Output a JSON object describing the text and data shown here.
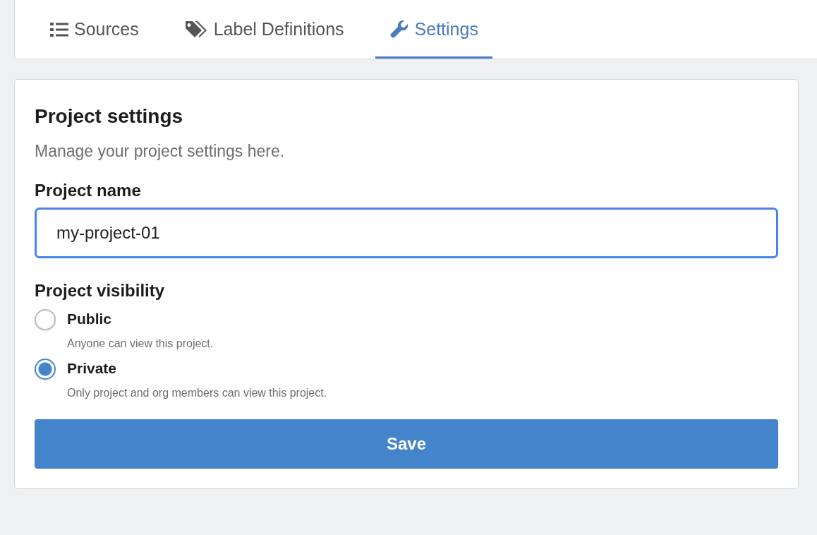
{
  "tabs": [
    {
      "label": "Sources",
      "selected": false
    },
    {
      "label": "Label Definitions",
      "selected": false
    },
    {
      "label": "Settings",
      "selected": true
    }
  ],
  "panel": {
    "title": "Project settings",
    "subtitle": "Manage your project settings here.",
    "name_field": {
      "label": "Project name",
      "value": "my-project-01",
      "focused": true
    },
    "visibility": {
      "label": "Project visibility",
      "options": [
        {
          "label": "Public",
          "description": "Anyone can view this project.",
          "selected": false
        },
        {
          "label": "Private",
          "description": "Only project and org members can view this project.",
          "selected": true
        }
      ]
    },
    "save_button": "Save"
  }
}
